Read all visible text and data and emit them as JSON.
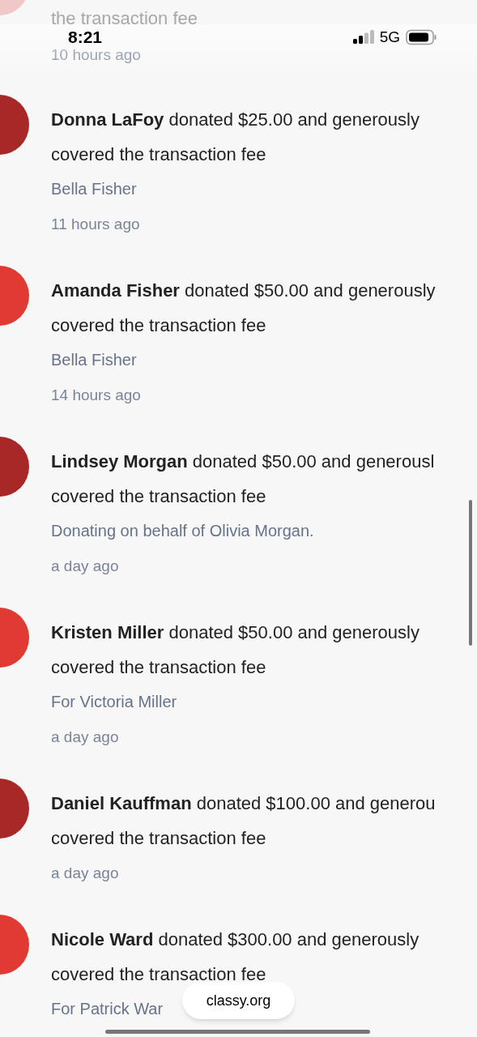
{
  "status_bar": {
    "time": "8:21",
    "network": "5G"
  },
  "donations": [
    {
      "kind": "partial",
      "color": "#f0c8c8",
      "lines": [
        "the transaction fee"
      ],
      "time": "10 hours ago"
    },
    {
      "kind": "full",
      "color": "#a82828",
      "lines": [
        "**Donna LaFoy** donated $25.00 and generously",
        "covered the transaction fee"
      ],
      "note": "Bella Fisher",
      "time": "11 hours ago"
    },
    {
      "kind": "full",
      "color": "#e03a33",
      "lines": [
        "**Amanda Fisher** donated $50.00 and generously",
        "covered the transaction fee"
      ],
      "note": "Bella Fisher",
      "time": "14 hours ago"
    },
    {
      "kind": "full",
      "color": "#a82828",
      "lines": [
        "**Lindsey Morgan** donated $50.00 and generousl",
        "covered the transaction fee"
      ],
      "note": "Donating on behalf of Olivia Morgan.",
      "time": "a day ago"
    },
    {
      "kind": "full",
      "color": "#e03a33",
      "lines": [
        "**Kristen Miller** donated $50.00 and generously",
        "covered the transaction fee"
      ],
      "note": "For Victoria Miller",
      "time": "a day ago"
    },
    {
      "kind": "full",
      "color": "#a82828",
      "lines": [
        "**Daniel Kauffman** donated $100.00 and generou",
        "covered the transaction fee"
      ],
      "time": "a day ago"
    },
    {
      "kind": "full",
      "color": "#e03a33",
      "lines": [
        "**Nicole Ward** donated $300.00 and generously",
        "covered the transaction fee"
      ],
      "note": "For Patrick War"
    }
  ],
  "browser": {
    "domain": "classy.org"
  }
}
